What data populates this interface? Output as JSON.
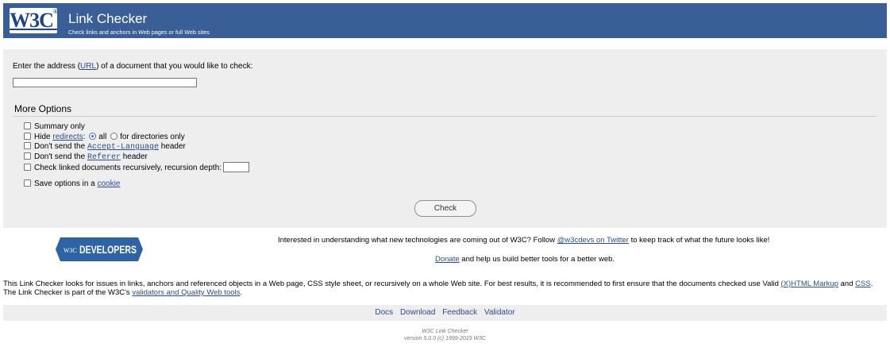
{
  "banner": {
    "logo_text": "W3C",
    "logo_mark": "®",
    "title": "Link Checker",
    "subtitle": "Check links and anchors in Web pages or full Web sites"
  },
  "form": {
    "url_prompt_before": "Enter the address (",
    "url_link": "URL",
    "url_prompt_after": ") of a document that you would like to check:",
    "uri_value": "",
    "more_options": "More Options",
    "opt_summary": "Summary only",
    "opt_hide_before": "Hide ",
    "opt_hide_link": "redirects",
    "opt_hide_colon": ":",
    "opt_all": "all",
    "opt_dirs": "for directories only",
    "opt_accept_before": "Don't send the ",
    "opt_accept_code": "Accept-Language",
    "opt_accept_after": " header",
    "opt_referer_before": "Don't send the ",
    "opt_referer_code": "Referer",
    "opt_referer_after": " header",
    "opt_recursive": "Check linked documents recursively, recursion depth:",
    "recursion_depth": "",
    "opt_save_before": "Save options in a ",
    "opt_save_link": "cookie",
    "check_label": "Check"
  },
  "promo": {
    "badge_w3c": "W3C",
    "badge_text": "DEVELOPERS",
    "interest_before": "Interested in understanding what new technologies are coming out of W3C? Follow ",
    "interest_link": "@w3cdevs on Twitter",
    "interest_after": " to keep track of what the future looks like!",
    "donate_link": "Donate",
    "donate_after": " and help us build better tools for a better web."
  },
  "about": {
    "line1_before": "This Link Checker looks for issues in links, anchors and referenced objects in a Web page, CSS style sheet, or recursively on a whole Web site. For best results, it is recommended to first ensure that the documents checked use Valid ",
    "html_link": "(X)HTML Markup",
    "and": " and ",
    "css_link": "CSS",
    "line1_end": ".",
    "line2_before": "The Link Checker is part of the W3C's ",
    "tools_link": "validators and Quality Web tools",
    "line2_end": "."
  },
  "footer": {
    "nav": [
      "Docs",
      "Download",
      "Feedback",
      "Validator"
    ],
    "colophon_line1": "W3C Link Checker",
    "colophon_line2": "version 5.0.0 (c) 1999-2019 W3C"
  },
  "colors": {
    "banner_bg": "#3a5f97",
    "panel_bg": "#eeeeee",
    "link": "#2b4c8c",
    "badge_bg": "#2e63a6"
  }
}
